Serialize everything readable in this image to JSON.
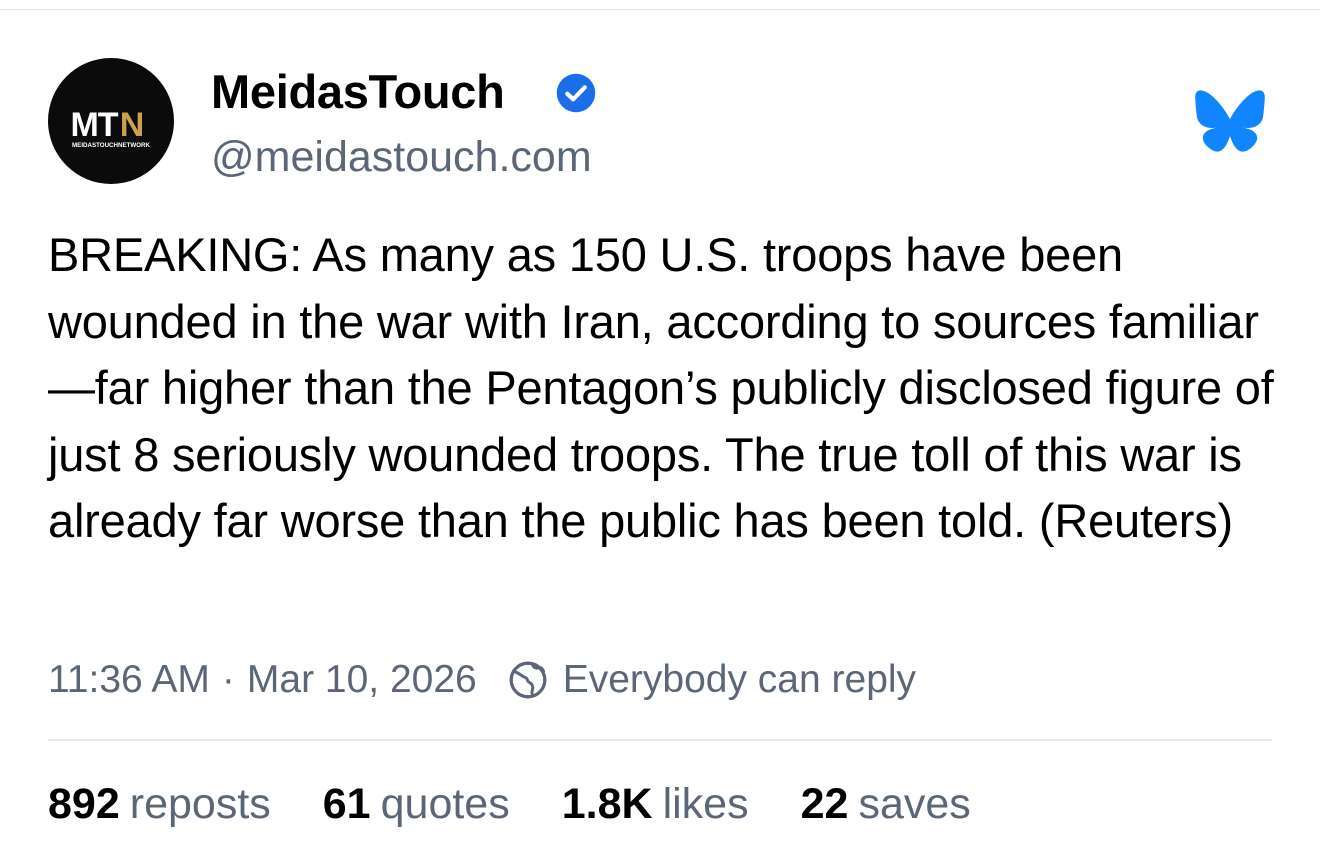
{
  "author": {
    "name": "MeidasTouch",
    "handle": "@meidastouch.com",
    "verified": true,
    "avatar_logo": {
      "text_mt": "MT",
      "text_n": "N",
      "subtitle": "MEIDASTOUCHNETWORK"
    }
  },
  "post": {
    "text": "BREAKING: As many as 150 U.S. troops have been wounded in the war with Iran, according to sources familiar—far higher than the Pentagon’s publicly disclosed figure of just 8 seriously wounded troops. The true toll of this war is already far worse than the public has been told. (Reuters)",
    "time": "11:36 AM",
    "separator": "·",
    "date": "Mar 10, 2026",
    "reply_setting": "Everybody can reply"
  },
  "stats": [
    {
      "count": "892",
      "label": "reposts"
    },
    {
      "count": "61",
      "label": "quotes"
    },
    {
      "count": "1.8K",
      "label": "likes"
    },
    {
      "count": "22",
      "label": "saves"
    }
  ],
  "colors": {
    "bluesky_blue": "#1185fe",
    "verified_blue": "#1A6FE8",
    "secondary_text": "#5b6676",
    "logo_gold": "#c9a24a",
    "avatar_bg": "#0b0b0b"
  },
  "icons": {
    "verified": "verified-badge-icon",
    "bluesky": "bluesky-butterfly-icon",
    "reply_setting": "globe-icon"
  }
}
